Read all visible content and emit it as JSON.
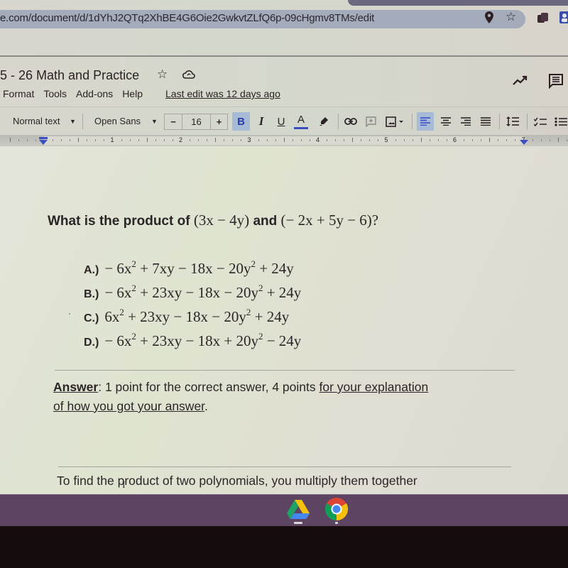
{
  "browser": {
    "url": "e.com/document/d/1dYhJ2QTq2XhBE4G6Oie2GwkvtZLfQ6p-09cHgmv8TMs/edit",
    "icons": [
      "location-pin-icon",
      "bookmark-star-icon",
      "extension-icon",
      "profile-icon"
    ]
  },
  "docs": {
    "title": "5 - 26 Math and Practice",
    "menu": [
      "Format",
      "Tools",
      "Add-ons",
      "Help"
    ],
    "last_edit": "Last edit was 12 days ago"
  },
  "toolbar": {
    "style": "Normal text",
    "font": "Open Sans",
    "font_size": "16",
    "minus": "−",
    "plus": "+",
    "bold": "B",
    "italic": "I",
    "underline": "U",
    "text_color": "A",
    "text_color_hex": "#3b4fc2",
    "active_hex": "#a7bad6"
  },
  "ruler": {
    "labels": [
      "1",
      "2",
      "3",
      "4",
      "5",
      "6",
      "7"
    ]
  },
  "document": {
    "question_prefix": "What is the product of",
    "question_factor1": "(3x − 4y)",
    "question_and": "and",
    "question_factor2": "(− 2x + 5y − 6)?",
    "options": [
      {
        "letter": "A.)",
        "parts": [
          "− 6x",
          "2",
          " + 7xy − 18x − 20y",
          "2",
          " + 24y"
        ]
      },
      {
        "letter": "B.)",
        "parts": [
          "− 6x",
          "2",
          " + 23xy − 18x − 20y",
          "2",
          " + 24y"
        ]
      },
      {
        "letter": "C.)",
        "parts": [
          "6x",
          "2",
          " + 23xy − 18x − 20y",
          "2",
          " + 24y"
        ]
      },
      {
        "letter": "D.)",
        "parts": [
          "− 6x",
          "2",
          " + 23xy − 18x + 20y",
          "2",
          " − 24y"
        ]
      }
    ],
    "answer_label": "Answer",
    "answer_text": ": 1 point for the correct answer, 4 points ",
    "answer_underlined": "for your explanation",
    "answer_line2_underlined": "of how you got your answer",
    "answer_line2_end": ".",
    "student_response": "To find the product of two polynomials, you multiply them together"
  },
  "shelf": {
    "apps": [
      "Google Drive",
      "Google Chrome"
    ],
    "color": "#5c4462"
  }
}
